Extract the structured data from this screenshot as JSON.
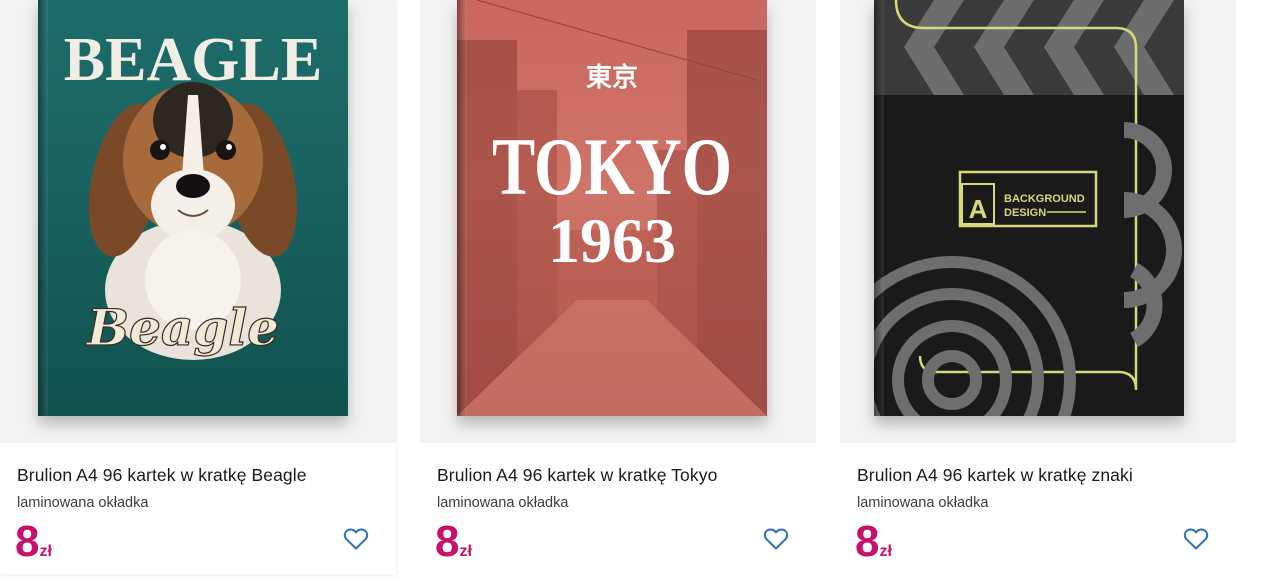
{
  "products": [
    {
      "title": "Brulion A4 96 kartek w kratkę Beagle",
      "subtitle": "laminowana okładka",
      "price_amount": "8",
      "price_currency": "zł",
      "cover_text_top": "BEAGLE",
      "cover_text_bottom": "Beagle",
      "favorite_icon": "heart-outline-icon"
    },
    {
      "title": "Brulion A4 96 kartek w kratkę Tokyo",
      "subtitle": "laminowana okładka",
      "price_amount": "8",
      "price_currency": "zł",
      "cover_text_kanji": "東京",
      "cover_text_main": "TOKYO",
      "cover_text_year": "1963",
      "favorite_icon": "heart-outline-icon"
    },
    {
      "title": "Brulion A4 96 kartek w kratkę znaki",
      "subtitle": "laminowana okładka",
      "price_amount": "8",
      "price_currency": "zł",
      "cover_badge_letter": "A",
      "cover_badge_line1": "BACKGROUND",
      "cover_badge_line2": "DESIGN",
      "favorite_icon": "heart-outline-icon"
    }
  ],
  "colors": {
    "price": "#c8106d",
    "heart": "#2f6fb6",
    "image_bg": "#f3f3f4"
  }
}
